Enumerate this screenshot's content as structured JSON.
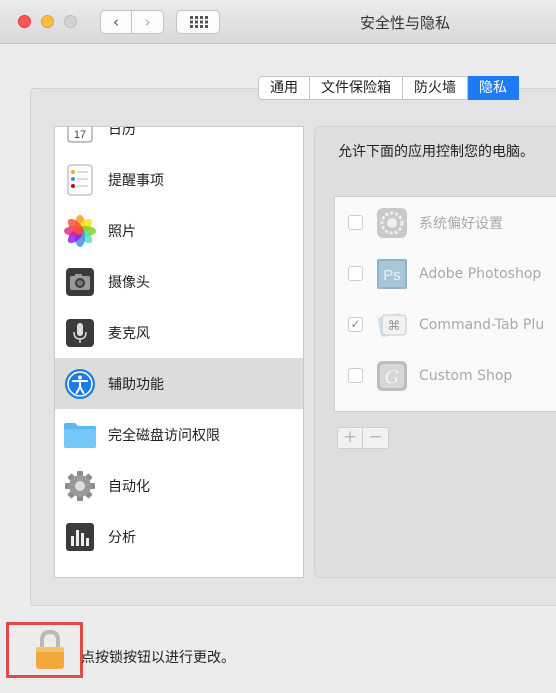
{
  "window": {
    "title": "安全性与隐私"
  },
  "tabs": [
    {
      "label": "通用",
      "active": false
    },
    {
      "label": "文件保险箱",
      "active": false
    },
    {
      "label": "防火墙",
      "active": false
    },
    {
      "label": "隐私",
      "active": true
    }
  ],
  "sidebar": {
    "items": [
      {
        "label": "日历",
        "icon": "calendar-icon"
      },
      {
        "label": "提醒事项",
        "icon": "reminders-icon"
      },
      {
        "label": "照片",
        "icon": "photos-icon"
      },
      {
        "label": "摄像头",
        "icon": "camera-icon"
      },
      {
        "label": "麦克风",
        "icon": "microphone-icon"
      },
      {
        "label": "辅助功能",
        "icon": "accessibility-icon",
        "selected": true
      },
      {
        "label": "完全磁盘访问权限",
        "icon": "folder-icon"
      },
      {
        "label": "自动化",
        "icon": "gear-icon"
      },
      {
        "label": "分析",
        "icon": "analytics-icon"
      }
    ]
  },
  "content": {
    "prompt": "允许下面的应用控制您的电脑。",
    "apps": [
      {
        "name": "系统偏好设置",
        "checked": false,
        "icon": "system-preferences-icon"
      },
      {
        "name": "Adobe Photoshop",
        "checked": false,
        "icon": "photoshop-icon"
      },
      {
        "name": "Command-Tab Plu",
        "checked": true,
        "icon": "command-tab-icon"
      },
      {
        "name": "Custom Shop",
        "checked": false,
        "icon": "custom-shop-icon"
      }
    ],
    "add_label": "+",
    "remove_label": "−"
  },
  "footer": {
    "lock_text": "点按锁按钮以进行更改。"
  },
  "colors": {
    "accent": "#1f7bf2",
    "highlight_box": "#e04b46"
  }
}
